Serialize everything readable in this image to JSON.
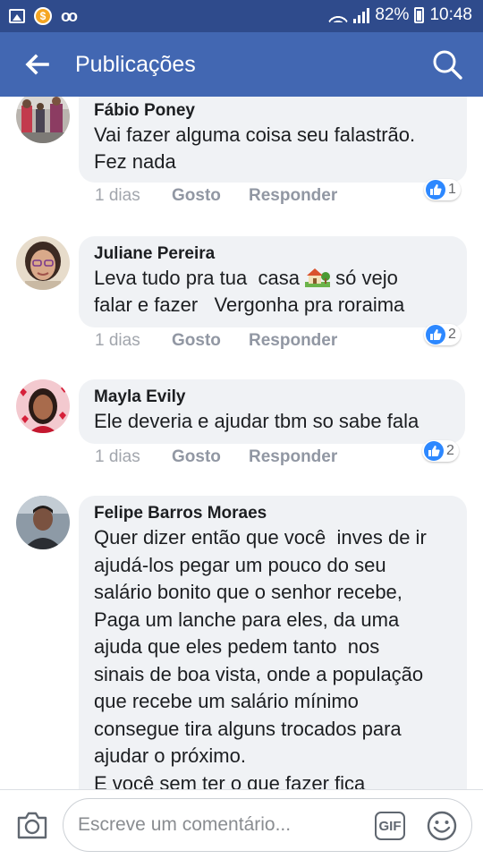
{
  "status_bar": {
    "battery": "82%",
    "time": "10:48",
    "icons": [
      "image-icon",
      "coin-icon",
      "voicemail-icon",
      "wifi-icon",
      "signal-icon",
      "battery-icon"
    ]
  },
  "header": {
    "title": "Publicações",
    "back_icon": "arrow-left-icon",
    "search_icon": "search-icon"
  },
  "comments": [
    {
      "author": "Fábio Poney",
      "text": "Vai fazer alguma coisa seu falastrão.\nFez nada",
      "time": "1 dias",
      "like_label": "Gosto",
      "reply_label": "Responder",
      "reactions": "1"
    },
    {
      "author": "Juliane Pereira",
      "text_before_emoji": "Leva tudo pra tua  casa ",
      "text_after_emoji": " só vejo\nfalar e fazer   Vergonha pra roraima",
      "emoji": "house-with-garden-icon",
      "time": "1 dias",
      "like_label": "Gosto",
      "reply_label": "Responder",
      "reactions": "2"
    },
    {
      "author": "Mayla Evily",
      "text": "Ele deveria e ajudar tbm so sabe fala",
      "time": "1 dias",
      "like_label": "Gosto",
      "reply_label": "Responder",
      "reactions": "2"
    },
    {
      "author": "Felipe Barros Moraes",
      "text": "Quer dizer então que você  inves de ir\najudá-los pegar um pouco do seu\nsalário bonito que o senhor recebe,\nPaga um lanche para eles, da uma\najuda que eles pedem tanto  nos\nsinais de boa vista, onde a população\nque recebe um salário mínimo\nconsegue tira alguns trocados para\najudar o próximo.\nE você sem ter o que fazer fica"
    }
  ],
  "composer": {
    "placeholder": "Escreve um comentário...",
    "gif_label": "GIF",
    "camera_icon": "camera-icon",
    "emoji_icon": "smiley-icon"
  },
  "colors": {
    "status_bar": "#2f4b8c",
    "app_bar": "#4267b2",
    "bubble": "#f0f2f5",
    "like_blue": "#2d88ff"
  }
}
